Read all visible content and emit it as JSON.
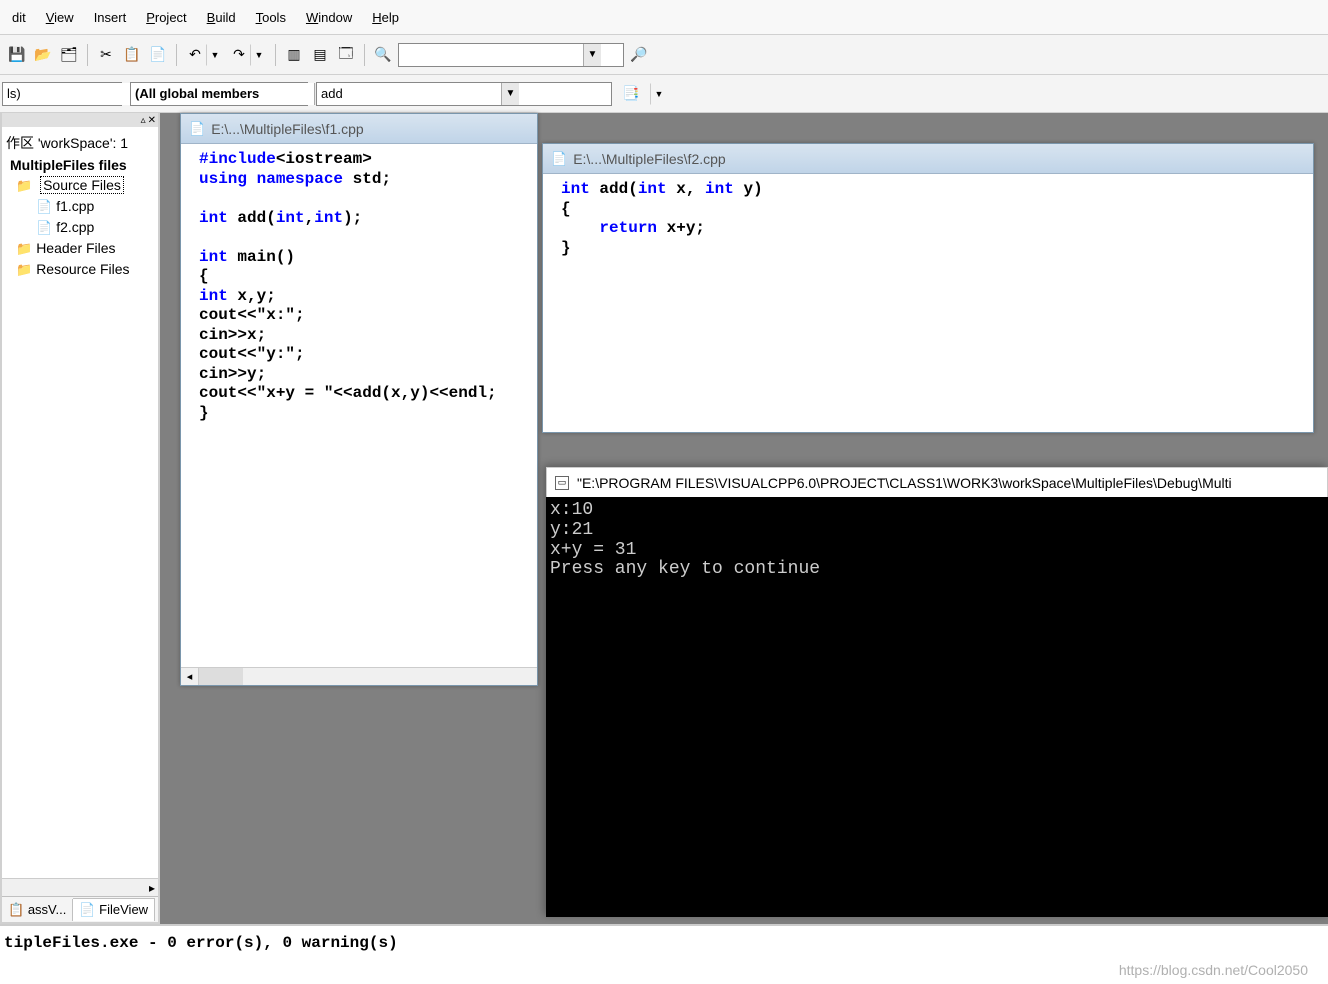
{
  "menus": {
    "edit": "dit",
    "view": "View",
    "insert": "Insert",
    "project": "Project",
    "build": "Build",
    "tools": "Tools",
    "window": "Window",
    "help": "Help"
  },
  "toolbar2": {
    "classCombo": "ls)",
    "memberCombo": "(All global members",
    "funcCombo": "add"
  },
  "tree": {
    "workspace": "作区 'workSpace': 1",
    "project": "MultipleFiles files",
    "source": "Source Files",
    "f1": "f1.cpp",
    "f2": "f2.cpp",
    "header": "Header Files",
    "resource": "Resource Files"
  },
  "sidetabs": {
    "classv": "assV...",
    "fileview": "FileView"
  },
  "editors": {
    "f1": {
      "title": "E:\\...\\MultipleFiles\\f1.cpp",
      "code_html": "<span class='kw'>#include</span>&lt;iostream&gt;\n<span class='kw'>using namespace</span> std;\n\n<span class='kw'>int</span> add(<span class='kw'>int</span>,<span class='kw'>int</span>);\n\n<span class='kw'>int</span> main()\n{\n<span class='kw'>int</span> x,y;\ncout&lt;&lt;\"x:\";\ncin&gt;&gt;x;\ncout&lt;&lt;\"y:\";\ncin&gt;&gt;y;\ncout&lt;&lt;\"x+y = \"&lt;&lt;add(x,y)&lt;&lt;endl;\n}"
    },
    "f2": {
      "title": "E:\\...\\MultipleFiles\\f2.cpp",
      "code_html": "<span class='kw'>int</span> add(<span class='kw'>int</span> x, <span class='kw'>int</span> y)\n{\n    <span class='kw'>return</span> x+y;\n}"
    }
  },
  "console": {
    "title": "\"E:\\PROGRAM FILES\\VISUALCPP6.0\\PROJECT\\CLASS1\\WORK3\\workSpace\\MultipleFiles\\Debug\\Multi",
    "body": "x:10\ny:21\nx+y = 31\nPress any key to continue"
  },
  "output": {
    "line": "tipleFiles.exe - 0 error(s), 0 warning(s)"
  },
  "watermark": "https://blog.csdn.net/Cool2050"
}
